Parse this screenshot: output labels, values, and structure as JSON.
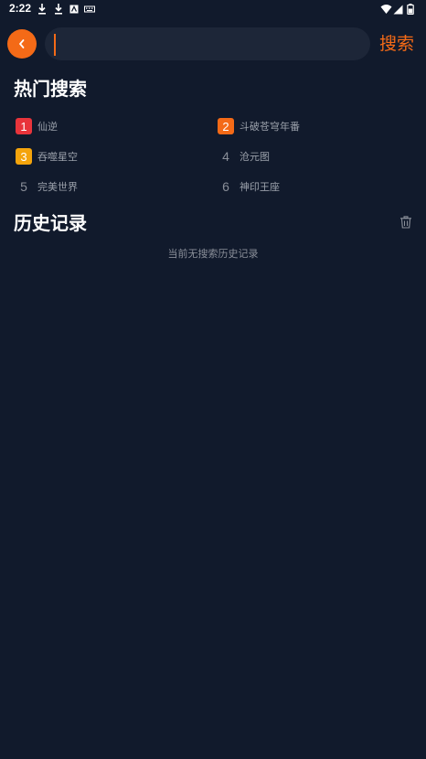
{
  "status_bar": {
    "time": "2:22"
  },
  "search": {
    "value": "",
    "placeholder": "",
    "button_label": "搜索"
  },
  "hot": {
    "title": "热门搜索",
    "items": [
      {
        "rank": "1",
        "name": "仙逆",
        "badge_color": "#e8343b"
      },
      {
        "rank": "2",
        "name": "斗破苍穹年番",
        "badge_color": "#f46a17"
      },
      {
        "rank": "3",
        "name": "吞噬星空",
        "badge_color": "#f4a40c"
      },
      {
        "rank": "4",
        "name": "沧元图"
      },
      {
        "rank": "5",
        "name": "完美世界"
      },
      {
        "rank": "6",
        "name": "神印王座"
      }
    ]
  },
  "history": {
    "title": "历史记录",
    "empty_text": "当前无搜索历史记录"
  },
  "colors": {
    "background": "#111a2c",
    "accent": "#f46a17",
    "search_box": "#1d2638"
  },
  "icons": {
    "back": "chevron-left-icon",
    "clear": "trash-icon"
  }
}
